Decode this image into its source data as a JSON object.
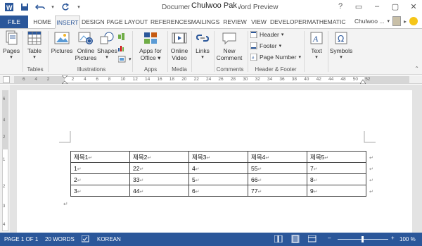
{
  "titlebar": {
    "doc_title": "Document1 - Microsoft Word Preview",
    "author_overlay": "Chulwoo Pak",
    "window_buttons": [
      "?",
      "▭",
      "–",
      "▢",
      "✕"
    ]
  },
  "tabs": {
    "file": "FILE",
    "items": [
      "HOME",
      "INSERT",
      "DESIGN",
      "PAGE LAYOUT",
      "REFERENCES",
      "MAILINGS",
      "REVIEW",
      "VIEW",
      "DEVELOPER",
      "MATHEMATIC"
    ],
    "active": "INSERT",
    "user_name": "Chulwoo ..."
  },
  "ribbon": {
    "pages": "Pages",
    "table": "Table",
    "pictures": "Pictures",
    "online_pictures_1": "Online",
    "online_pictures_2": "Pictures",
    "shapes": "Shapes",
    "apps_1": "Apps for",
    "apps_2": "Office",
    "online_video_1": "Online",
    "online_video_2": "Video",
    "links": "Links",
    "comment_1": "New",
    "comment_2": "Comment",
    "header": "Header",
    "footer": "Footer",
    "page_number": "Page Number",
    "text": "Text",
    "symbols": "Symbols",
    "groups": {
      "tables": "Tables",
      "illustrations": "Illustrations",
      "apps": "Apps",
      "media": "Media",
      "comments": "Comments",
      "header_footer": "Header & Footer"
    }
  },
  "ruler": {
    "numbers": [
      "6",
      "4",
      "2",
      "",
      "2",
      "4",
      "6",
      "8",
      "10",
      "12",
      "14",
      "16",
      "18",
      "20",
      "22",
      "24",
      "26",
      "28",
      "30",
      "32",
      "34",
      "36",
      "38",
      "40",
      "42",
      "44",
      "48",
      "50",
      "52"
    ],
    "vnumbers": [
      "6",
      "4",
      "2",
      "1",
      "2",
      "3",
      "4"
    ]
  },
  "document": {
    "table": [
      [
        "제목1",
        "제목2",
        "제목3",
        "제목4",
        "제목5"
      ],
      [
        "1",
        "22",
        "4",
        "55",
        "7"
      ],
      [
        "2",
        "33",
        "5",
        "66",
        "8"
      ],
      [
        "3",
        "44",
        "6",
        "77",
        "9"
      ]
    ],
    "cell_mark": "↵"
  },
  "status": {
    "page": "PAGE 1 OF 1",
    "words": "20 WORDS",
    "language": "KOREAN",
    "zoom": "100 %"
  }
}
